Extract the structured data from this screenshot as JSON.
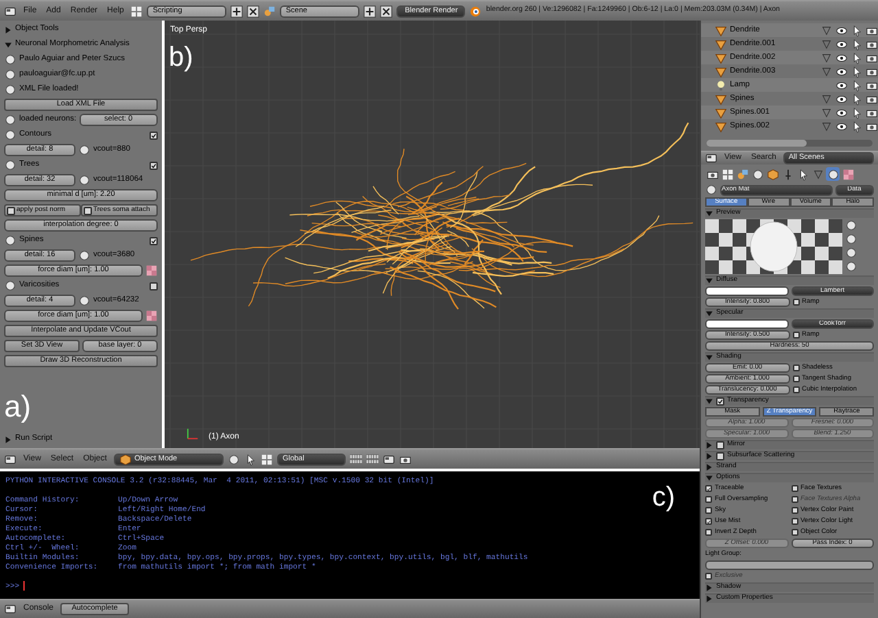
{
  "top_bar": {
    "menus": [
      "File",
      "Add",
      "Render",
      "Help"
    ],
    "screen_layout": "Scripting",
    "scene": "Scene",
    "render_engine": "Blender Render",
    "stats": "blender.org 260 | Ve:1296082 | Fa:1249960 | Ob:6-12 | La:0 | Mem:203.03M (0.34M) | Axon"
  },
  "tool_panel": {
    "items": [
      {
        "kind": "section",
        "title": "Object Tools",
        "expanded": false
      },
      {
        "kind": "section",
        "title": "Neuronal Morphometric Analysis",
        "expanded": true
      },
      {
        "kind": "label",
        "text": "Paulo Aguiar and Peter Szucs"
      },
      {
        "kind": "label",
        "text": "pauloaguiar@fc.up.pt"
      },
      {
        "kind": "label",
        "text": "XML File loaded!"
      },
      {
        "kind": "button",
        "text": "Load XML File"
      },
      {
        "kind": "select_row",
        "label": "loaded neurons:",
        "value": "select: 0"
      },
      {
        "kind": "check",
        "text": "Contours",
        "checked": true
      },
      {
        "kind": "slider_readout",
        "field": "detail: 8",
        "reading": "vcout=880"
      },
      {
        "kind": "check",
        "text": "Trees",
        "checked": true
      },
      {
        "kind": "slider_readout",
        "field": "detail: 32",
        "reading": "vcout=118064"
      },
      {
        "kind": "slider",
        "field": "minimal d [um]: 2.20"
      },
      {
        "kind": "toggle_pair",
        "items": [
          {
            "text": "apply post norm",
            "checked": false
          },
          {
            "text": "Trees soma attach",
            "checked": false
          }
        ]
      },
      {
        "kind": "slider",
        "field": "interpolation degree: 0"
      },
      {
        "kind": "check",
        "text": "Spines",
        "checked": true
      },
      {
        "kind": "slider_readout",
        "field": "detail: 16",
        "reading": "vcout=3680"
      },
      {
        "kind": "slider_swatch",
        "field": "force diam [um]: 1.00"
      },
      {
        "kind": "check",
        "text": "Varicosities",
        "checked": false
      },
      {
        "kind": "slider_readout",
        "field": "detail: 4",
        "reading": "vcout=64232"
      },
      {
        "kind": "slider_swatch",
        "field": "force diam [um]: 1.00"
      },
      {
        "kind": "button",
        "text": "Interpolate and Update VCout"
      },
      {
        "kind": "button_field",
        "button": "Set 3D View",
        "field": "base layer: 0"
      },
      {
        "kind": "button",
        "text": "Draw 3D Reconstruction"
      },
      {
        "kind": "annotation",
        "text": "a)"
      },
      {
        "kind": "section",
        "title": "Run Script",
        "expanded": false
      }
    ]
  },
  "viewport": {
    "view_name": "Top Persp",
    "active_object": "(1) Axon",
    "annotation": "b)"
  },
  "viewport_header": {
    "menus": [
      "View",
      "Select",
      "Object"
    ],
    "mode": "Object Mode",
    "orientation": "Global"
  },
  "outliner": {
    "items": [
      {
        "name": "Dendrite",
        "kind": "mesh"
      },
      {
        "name": "Dendrite.001",
        "kind": "mesh"
      },
      {
        "name": "Dendrite.002",
        "kind": "mesh"
      },
      {
        "name": "Dendrite.003",
        "kind": "mesh"
      },
      {
        "name": "Lamp",
        "kind": "lamp"
      },
      {
        "name": "Spines",
        "kind": "mesh"
      },
      {
        "name": "Spines.001",
        "kind": "mesh"
      },
      {
        "name": "Spines.002",
        "kind": "mesh"
      }
    ],
    "header": {
      "menus": [
        "View",
        "Search"
      ],
      "filter": "All Scenes"
    }
  },
  "properties": {
    "context_tabs": [
      {
        "kind": "render",
        "selected": false
      },
      {
        "kind": "layers",
        "selected": false
      },
      {
        "kind": "scene",
        "selected": false
      },
      {
        "kind": "world",
        "selected": false
      },
      {
        "kind": "object",
        "selected": false
      },
      {
        "kind": "constraints",
        "selected": false
      },
      {
        "kind": "modifiers",
        "selected": false
      },
      {
        "kind": "data",
        "selected": false
      },
      {
        "kind": "material",
        "selected": true
      },
      {
        "kind": "texture",
        "selected": false
      }
    ],
    "material": {
      "name": "Axon Mat",
      "link": "Data"
    },
    "tabs": [
      {
        "label": "Surface",
        "selected": true
      },
      {
        "label": "Wire",
        "selected": false
      },
      {
        "label": "Volume",
        "selected": false
      },
      {
        "label": "Halo",
        "selected": false
      }
    ],
    "panels": [
      {
        "title": "Preview",
        "expanded": true,
        "rows": [
          {
            "cells": [
              {
                "kind": "preview"
              }
            ]
          }
        ]
      },
      {
        "title": "Diffuse",
        "expanded": true,
        "rows": [
          {
            "cells": [
              {
                "kind": "color",
                "color": "#ffffff"
              },
              {
                "kind": "select",
                "text": "Lambert"
              }
            ]
          },
          {
            "cells": [
              {
                "kind": "field",
                "text": "Intensity: 0.800",
                "disabled": false
              },
              {
                "kind": "check",
                "text": "Ramp",
                "checked": false,
                "disabled": false
              }
            ]
          }
        ]
      },
      {
        "title": "Specular",
        "expanded": true,
        "rows": [
          {
            "cells": [
              {
                "kind": "color",
                "color": "#ffffff"
              },
              {
                "kind": "select",
                "text": "CookTorr"
              }
            ]
          },
          {
            "cells": [
              {
                "kind": "field",
                "text": "Intensity: 0.500",
                "disabled": false
              },
              {
                "kind": "check",
                "text": "Ramp",
                "checked": false,
                "disabled": false
              }
            ]
          },
          {
            "cells": [
              {
                "kind": "field",
                "text": "Hardness: 50",
                "disabled": false
              }
            ]
          }
        ]
      },
      {
        "title": "Shading",
        "expanded": true,
        "rows": [
          {
            "cells": [
              {
                "kind": "field",
                "text": "Emit: 0.00",
                "disabled": false
              },
              {
                "kind": "check",
                "text": "Shadeless",
                "checked": false,
                "disabled": false
              }
            ]
          },
          {
            "cells": [
              {
                "kind": "field",
                "text": "Ambient: 1.000",
                "disabled": false
              },
              {
                "kind": "check",
                "text": "Tangent Shading",
                "checked": false,
                "disabled": false
              }
            ]
          },
          {
            "cells": [
              {
                "kind": "field",
                "text": "Translucency: 0.000",
                "disabled": false
              },
              {
                "kind": "check",
                "text": "Cubic Interpolation",
                "checked": false,
                "disabled": false
              }
            ]
          }
        ]
      },
      {
        "title": "Transparency",
        "expanded": true,
        "check": true,
        "rows": [
          {
            "cells": [
              {
                "kind": "tab",
                "text": "Mask",
                "selected": false
              },
              {
                "kind": "tab",
                "text": "Z Transparency",
                "selected": true
              },
              {
                "kind": "tab",
                "text": "Raytrace",
                "selected": false
              }
            ]
          },
          {
            "cells": [
              {
                "kind": "field",
                "text": "Alpha: 1.000",
                "disabled": true
              },
              {
                "kind": "field",
                "text": "Fresnel: 0.000",
                "disabled": true
              }
            ]
          },
          {
            "cells": [
              {
                "kind": "field",
                "text": "Specular: 1.000",
                "disabled": true
              },
              {
                "kind": "field",
                "text": "Blend: 1.250",
                "disabled": true
              }
            ]
          }
        ]
      },
      {
        "title": "Mirror",
        "expanded": false,
        "check": false
      },
      {
        "title": "Subsurface Scattering",
        "expanded": false,
        "check": false
      },
      {
        "title": "Strand",
        "expanded": false
      },
      {
        "title": "Options",
        "expanded": true,
        "rows": [
          {
            "cells": [
              {
                "kind": "check",
                "text": "Traceable",
                "checked": true,
                "disabled": false
              },
              {
                "kind": "check",
                "text": "Face Textures",
                "checked": false,
                "disabled": false
              }
            ]
          },
          {
            "cells": [
              {
                "kind": "check",
                "text": "Full Oversampling",
                "checked": false,
                "disabled": false
              },
              {
                "kind": "check",
                "text": "Face Textures Alpha",
                "checked": false,
                "disabled": true
              }
            ]
          },
          {
            "cells": [
              {
                "kind": "check",
                "text": "Sky",
                "checked": false,
                "disabled": false
              },
              {
                "kind": "check",
                "text": "Vertex Color Paint",
                "checked": false,
                "disabled": false
              }
            ]
          },
          {
            "cells": [
              {
                "kind": "check",
                "text": "Use Mist",
                "checked": true,
                "disabled": false
              },
              {
                "kind": "check",
                "text": "Vertex Color Light",
                "checked": false,
                "disabled": false
              }
            ]
          },
          {
            "cells": [
              {
                "kind": "check",
                "text": "Invert Z Depth",
                "checked": false,
                "disabled": false
              },
              {
                "kind": "check",
                "text": "Object Color",
                "checked": false,
                "disabled": false
              }
            ]
          },
          {
            "cells": [
              {
                "kind": "field",
                "text": "Z Offset: 0.000",
                "disabled": true
              },
              {
                "kind": "field",
                "text": "Pass Index: 0",
                "disabled": false
              }
            ]
          },
          {
            "cells": [
              {
                "kind": "text",
                "text": "Light Group:"
              }
            ]
          },
          {
            "cells": [
              {
                "kind": "input"
              }
            ]
          },
          {
            "cells": [
              {
                "kind": "check",
                "text": "Exclusive",
                "checked": false,
                "disabled": true
              }
            ]
          }
        ]
      },
      {
        "title": "Shadow",
        "expanded": false
      },
      {
        "title": "Custom Properties",
        "expanded": false
      }
    ]
  },
  "console": {
    "banner": "PYTHON INTERACTIVE CONSOLE 3.2 (r32:88445, Mar  4 2011, 02:13:51) [MSC v.1500 32 bit (Intel)]",
    "help": [
      {
        "key": "Command History:",
        "value": "Up/Down Arrow"
      },
      {
        "key": "Cursor:",
        "value": "Left/Right Home/End"
      },
      {
        "key": "Remove:",
        "value": "Backspace/Delete"
      },
      {
        "key": "Execute:",
        "value": "Enter"
      },
      {
        "key": "Autocomplete:",
        "value": "Ctrl+Space"
      },
      {
        "key": "Ctrl +/-  Wheel:",
        "value": "Zoom"
      },
      {
        "key": "Builtin Modules:",
        "value": "bpy, bpy.data, bpy.ops, bpy.props, bpy.types, bpy.context, bpy.utils, bgl, blf, mathutils"
      },
      {
        "key": "Convenience Imports:",
        "value": "from mathutils import *; from math import *"
      }
    ],
    "prompt": ">>>",
    "annotation": "c)"
  },
  "console_header": {
    "menus": [
      "Console"
    ],
    "buttons": [
      "Autocomplete"
    ]
  }
}
